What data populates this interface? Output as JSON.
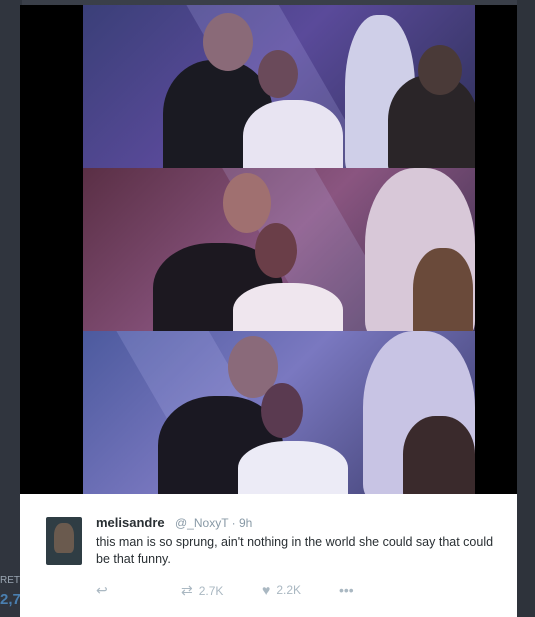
{
  "background": {
    "edge_label": "RET",
    "edge_number": "2,7"
  },
  "tweet": {
    "display_name": "melisandre",
    "handle": "@_NoxyT",
    "separator": "·",
    "time": "9h",
    "text": "this man is so sprung, ain't nothing in the world she could say  that could be that funny.",
    "actions": {
      "reply_icon": "reply-icon",
      "retweet_icon": "retweet-icon",
      "retweet_count": "2.7K",
      "like_icon": "heart-icon",
      "like_count": "2.2K",
      "more_icon": "more-icon"
    }
  },
  "colors": {
    "name": "#292f33",
    "meta": "#8899a6",
    "action_icon": "#aab8c2"
  }
}
